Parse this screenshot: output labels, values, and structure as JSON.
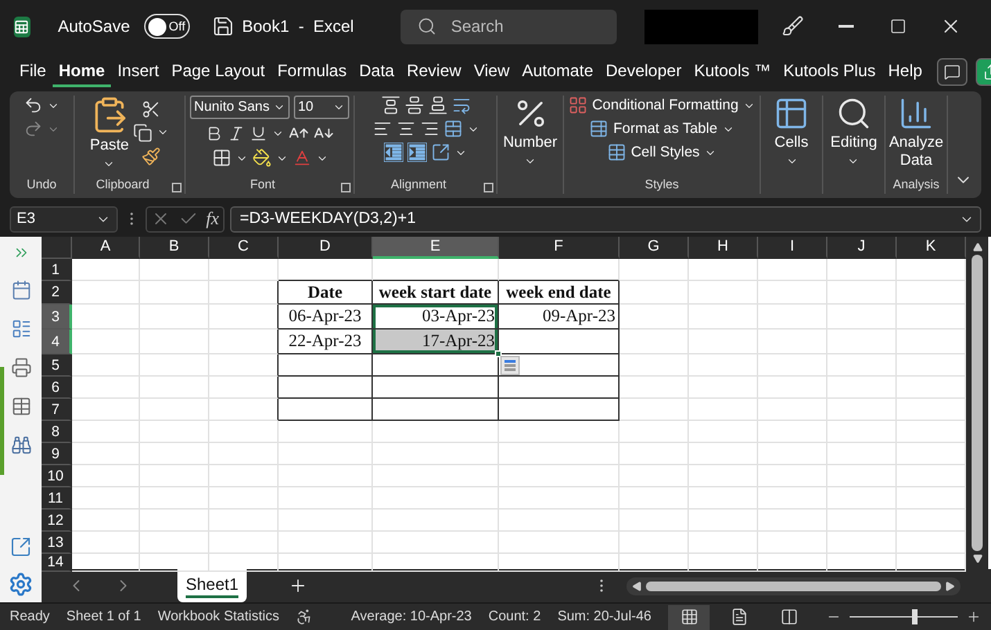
{
  "title_bar": {
    "autosave_label": "AutoSave",
    "autosave": {
      "on": false,
      "label": "Off"
    },
    "document_title": "Book1  -  Excel",
    "search": {
      "placeholder": "Search"
    }
  },
  "menu_tabs": [
    {
      "label": "File",
      "selected": false
    },
    {
      "label": "Home",
      "selected": true
    },
    {
      "label": "Insert",
      "selected": false
    },
    {
      "label": "Page Layout",
      "selected": false
    },
    {
      "label": "Formulas",
      "selected": false
    },
    {
      "label": "Data",
      "selected": false
    },
    {
      "label": "Review",
      "selected": false
    },
    {
      "label": "View",
      "selected": false
    },
    {
      "label": "Automate",
      "selected": false
    },
    {
      "label": "Developer",
      "selected": false
    },
    {
      "label": "Kutools ™",
      "selected": false
    },
    {
      "label": "Kutools Plus",
      "selected": false
    },
    {
      "label": "Help",
      "selected": false
    }
  ],
  "ribbon": [
    {
      "kind": "undo",
      "label": "Undo",
      "launcher": false
    },
    {
      "kind": "clipboard",
      "label": "Clipboard",
      "launcher": true,
      "paste_label": "Paste"
    },
    {
      "kind": "font",
      "label": "Font",
      "launcher": true,
      "font_name": "Nunito Sans",
      "font_size": "10"
    },
    {
      "kind": "alignment",
      "label": "Alignment",
      "launcher": true
    },
    {
      "kind": "number",
      "launcher": false,
      "button_label": "Number"
    },
    {
      "kind": "styles",
      "label": "Styles",
      "launcher": false,
      "items": [
        "Conditional Formatting",
        "Format as Table",
        "Cell Styles"
      ]
    },
    {
      "kind": "cells",
      "launcher": false,
      "button_label": "Cells"
    },
    {
      "kind": "editing",
      "launcher": false,
      "button_label": "Editing"
    },
    {
      "kind": "analysis",
      "label": "Analysis",
      "launcher": false,
      "button_label": "Analyze Data"
    }
  ],
  "formula_bar": {
    "name_box": "E3",
    "fx": "fx",
    "formula": "=D3-WEEKDAY(D3,2)+1"
  },
  "sheet": {
    "columns": [
      {
        "label": "A",
        "selected": false
      },
      {
        "label": "B",
        "selected": false
      },
      {
        "label": "C",
        "selected": false
      },
      {
        "label": "D",
        "selected": false
      },
      {
        "label": "E",
        "selected": true
      },
      {
        "label": "F",
        "selected": false
      },
      {
        "label": "G",
        "selected": false
      },
      {
        "label": "H",
        "selected": false
      },
      {
        "label": "I",
        "selected": false
      },
      {
        "label": "J",
        "selected": false
      },
      {
        "label": "K",
        "selected": false
      }
    ],
    "rows": [
      {
        "label": "1",
        "selected": false
      },
      {
        "label": "2",
        "selected": false
      },
      {
        "label": "3",
        "selected": true
      },
      {
        "label": "4",
        "selected": true
      },
      {
        "label": "5",
        "selected": false
      },
      {
        "label": "6",
        "selected": false
      },
      {
        "label": "7",
        "selected": false
      },
      {
        "label": "8",
        "selected": false
      },
      {
        "label": "9",
        "selected": false
      },
      {
        "label": "10",
        "selected": false
      },
      {
        "label": "11",
        "selected": false
      },
      {
        "label": "12",
        "selected": false
      },
      {
        "label": "13",
        "selected": false
      },
      {
        "label": "14",
        "selected": false
      }
    ],
    "table": {
      "header": [
        "Date",
        "week start date",
        "week end date"
      ],
      "rows": [
        {
          "date": "06-Apr-23",
          "week_start": "03-Apr-23",
          "week_end": "09-Apr-23",
          "selected": true,
          "active": true
        },
        {
          "date": "22-Apr-23",
          "week_start": "17-Apr-23",
          "selected": true,
          "active": false
        }
      ]
    }
  },
  "sheet_tabs": [
    {
      "label": "Sheet1",
      "selected": true
    }
  ],
  "status_bar": {
    "mode": "Ready",
    "sheet_info": "Sheet 1 of 1",
    "workbook_statistics": "Workbook Statistics",
    "average": "Average: 10-Apr-23",
    "count": "Count: 2",
    "sum": "Sum: 20-Jul-46",
    "views": [
      {
        "kind": "normal",
        "selected": true
      },
      {
        "kind": "page_layout",
        "selected": false
      },
      {
        "kind": "page_break",
        "selected": false
      }
    ],
    "zoom": {
      "level": 0.6
    }
  }
}
